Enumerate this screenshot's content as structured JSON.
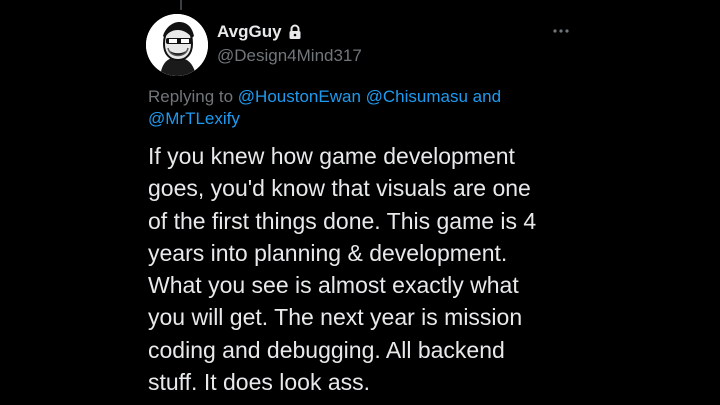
{
  "author": {
    "display_name": "AvgGuy",
    "handle": "@Design4Mind317",
    "protected_icon": "lock-icon",
    "avatar_icon": "sketch-portrait-avatar"
  },
  "menu_icon": "more-horizontal-icon",
  "reply_context": {
    "prefix": "Replying to",
    "mentions": [
      "@HoustonEwan",
      "@Chisumasu",
      "@MrTLexify"
    ],
    "joiner": "and"
  },
  "tweet": {
    "lines": [
      "If you knew how game development",
      "goes, you'd know that visuals are one",
      "of the first things done. This game is 4",
      "years into planning & development.",
      "What you see is almost exactly what",
      "you will get. The next year is mission",
      "coding and debugging. All backend",
      "stuff. It does look ass."
    ]
  },
  "colors": {
    "background": "#000000",
    "primary_text": "#e7e9ea",
    "secondary_text": "#71767b",
    "link": "#1d9bf0"
  }
}
